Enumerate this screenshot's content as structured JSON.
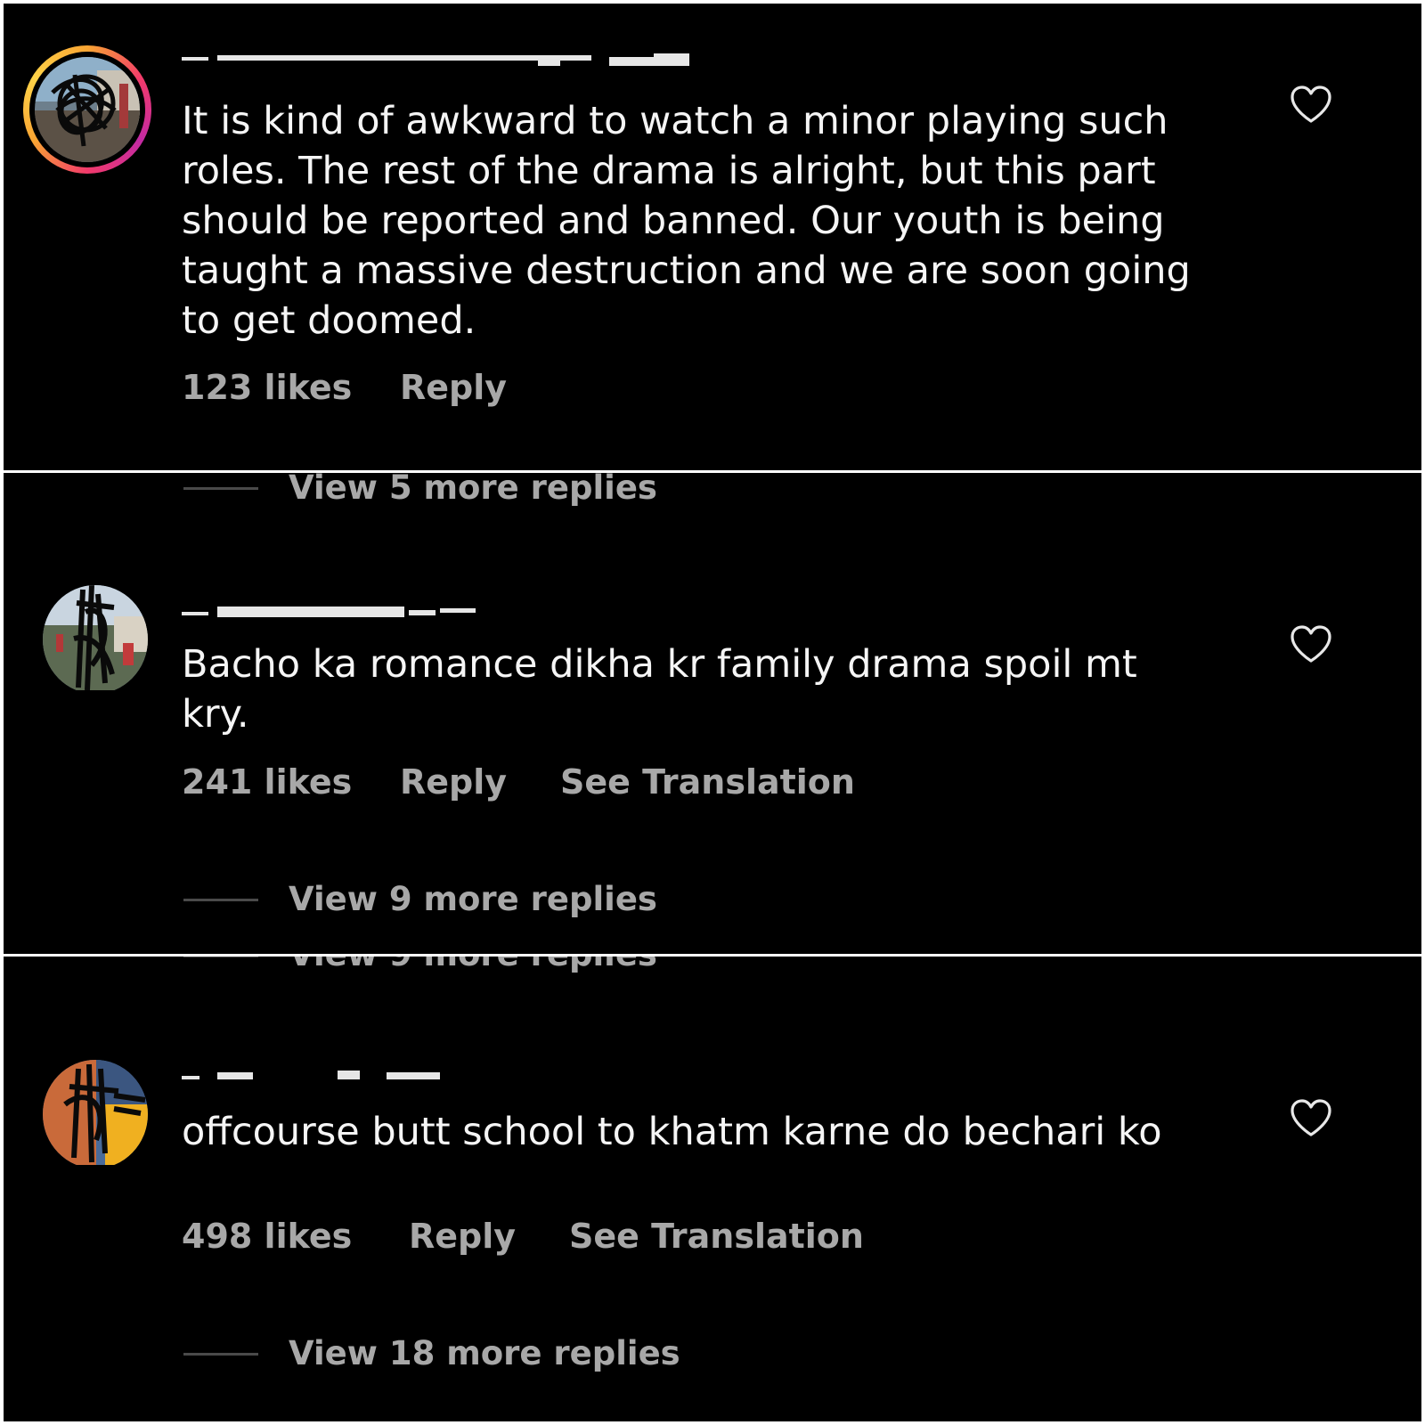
{
  "comments": [
    {
      "text": "It is kind of awkward to watch a minor playing such roles. The rest of the drama is alright, but this part should be reported and banned. Our youth is being taught a massive destruction and we are soon going to get doomed.",
      "likes": "123 likes",
      "reply": "Reply",
      "view_replies": "View 5 more replies"
    },
    {
      "text": "Bacho ka romance dikha kr family drama spoil mt kry.",
      "likes": "241 likes",
      "reply": "Reply",
      "translate": "See Translation",
      "view_replies": "View 9 more replies"
    },
    {
      "text": "offcourse butt school to khatm karne do bechari ko",
      "likes": "498 likes",
      "reply": "Reply",
      "translate": "See Translation",
      "view_replies": "View 18 more replies"
    }
  ],
  "ghost_label": "View 9 more replies",
  "colors": {
    "background": "#000000",
    "text": "#f5f5f5",
    "meta": "#a8a8a8",
    "divider": "#ffffff"
  },
  "icons": {
    "like": "heart-outline-icon"
  }
}
